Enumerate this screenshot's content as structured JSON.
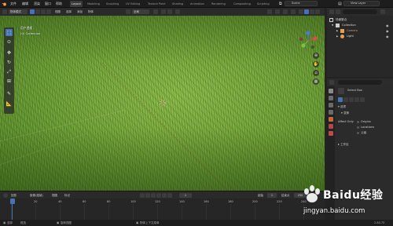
{
  "menubar": {
    "items": [
      "文件",
      "编辑",
      "渲染",
      "窗口",
      "帮助"
    ],
    "workspaces": [
      "Layout",
      "Modeling",
      "Sculpting",
      "UV Editing",
      "Texture Paint",
      "Shading",
      "Animation",
      "Rendering",
      "Compositing",
      "Scripting"
    ],
    "active_workspace": "Layout",
    "scene": "Scene",
    "view_layer": "View Layer"
  },
  "viewport_header": {
    "mode": "物体模式",
    "menus": [
      "视图",
      "选择",
      "添加",
      "物体"
    ],
    "transform_orientation": "全局"
  },
  "viewport": {
    "view_name": "用户透视",
    "collection_info": "(0) Collection"
  },
  "outliner": {
    "header_label": "场景集合",
    "items": [
      {
        "label": "Collection",
        "color": "#d8d8d8",
        "icon_color": "#cfcfcf"
      },
      {
        "label": "Camera",
        "color": "#e88a7a",
        "icon_color": "#e3a04d"
      },
      {
        "label": "Light",
        "color": "#d8d8d8",
        "icon_color": "#e3a04d"
      }
    ]
  },
  "properties": {
    "tool_name": "Select Box",
    "section_options": "选项",
    "section_transform": "变换",
    "affect_only_label": "Affect Only",
    "affect_options": [
      "Origins",
      "Locations",
      "父级"
    ],
    "section_workspace": "工作区"
  },
  "timeline": {
    "menus": [
      "回放",
      "抠像(插帧)",
      "视图",
      "标记"
    ],
    "current_frame": "1",
    "start_label": "起始",
    "start_value": "1",
    "end_label": "结束点",
    "end_value": "250",
    "ticks": [
      "0",
      "20",
      "40",
      "60",
      "80",
      "100",
      "120",
      "140",
      "160",
      "180",
      "200",
      "220",
      "240"
    ]
  },
  "statusbar": {
    "items": [
      "选择",
      "框选",
      "旋转视图",
      "物体上下文菜单"
    ],
    "version": "2.80.75"
  },
  "watermark": {
    "brand": "Baidu经验",
    "url": "jingyan.baidu.com"
  },
  "colors": {
    "accent": "#4772b3",
    "grass": "#73a43a"
  }
}
